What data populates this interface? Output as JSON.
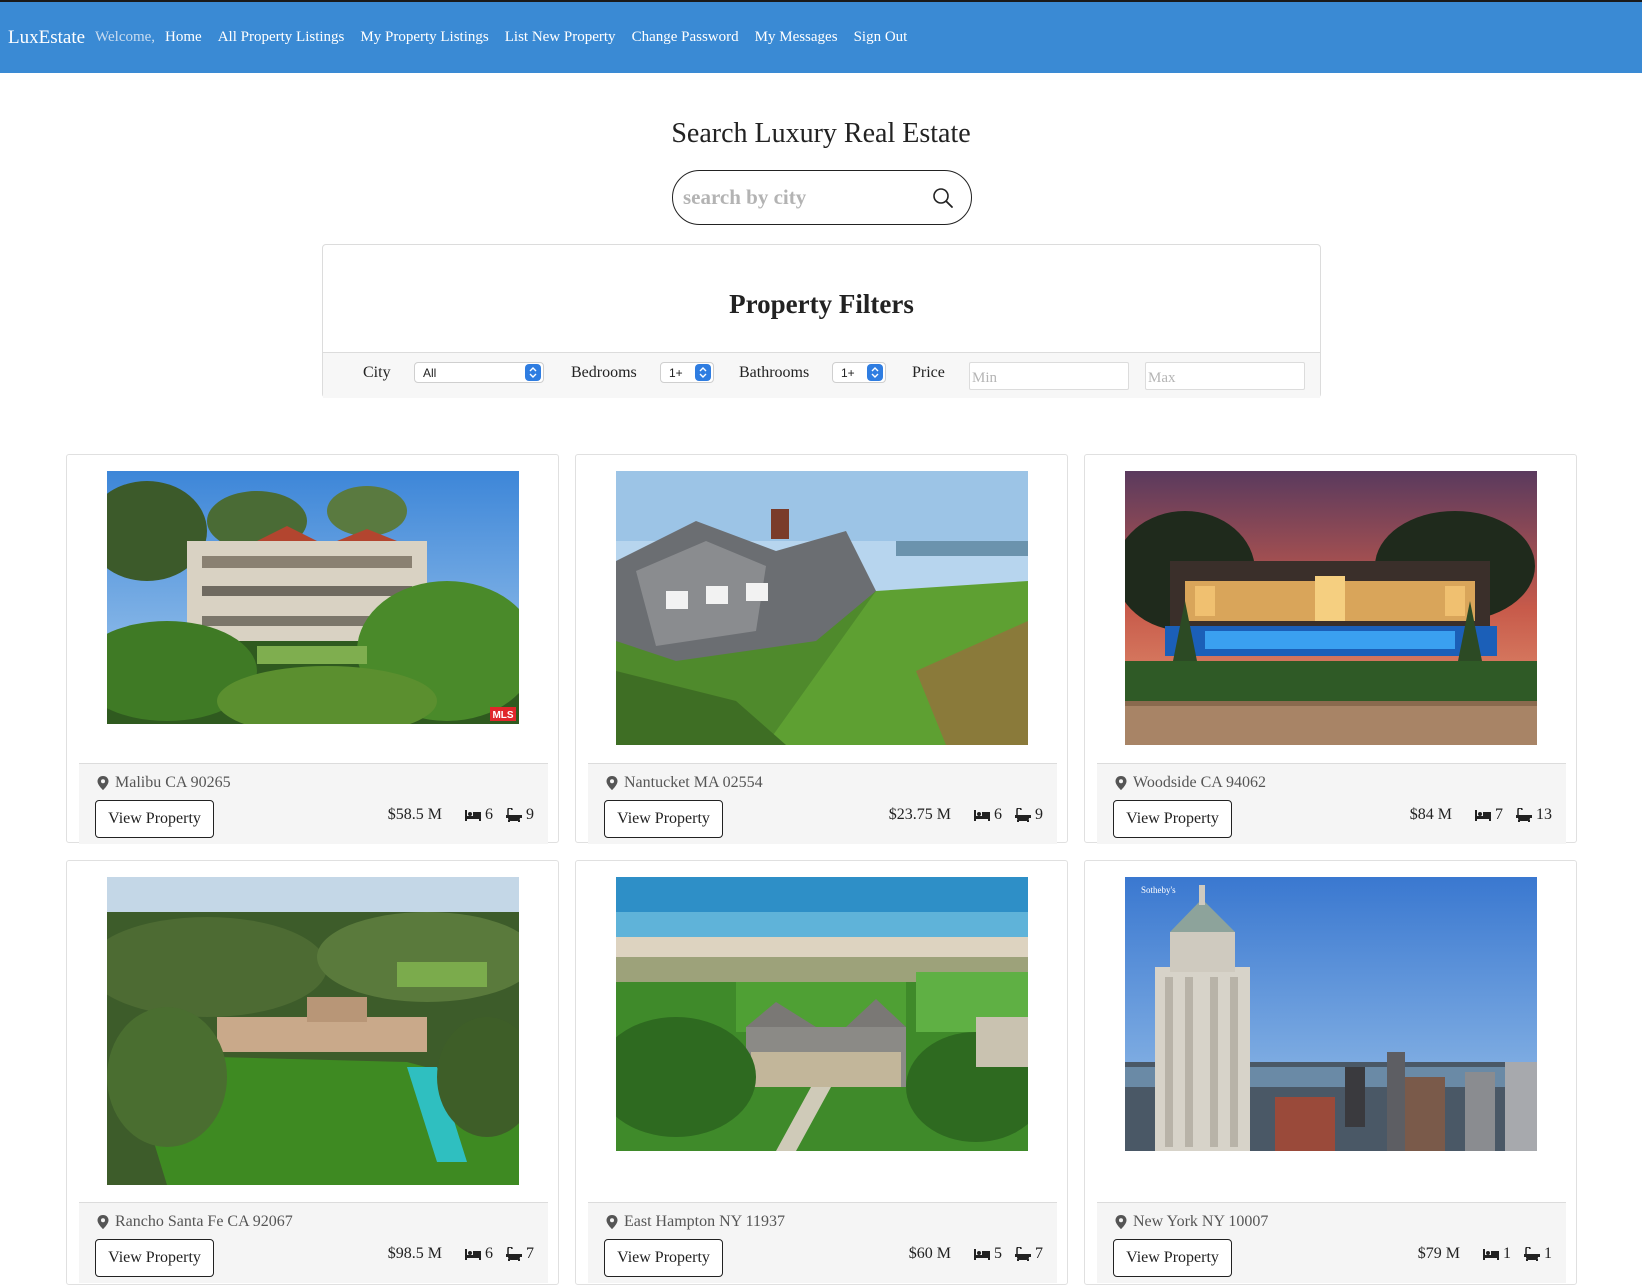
{
  "nav": {
    "brand": "LuxEstate",
    "welcome": "Welcome,",
    "links": [
      "Home",
      "All Property Listings",
      "My Property Listings",
      "List New Property",
      "Change Password",
      "My Messages",
      "Sign Out"
    ]
  },
  "search": {
    "title": "Search Luxury Real Estate",
    "placeholder": "search by city"
  },
  "filters": {
    "title": "Property Filters",
    "city_label": "City",
    "city_value": "All",
    "bedrooms_label": "Bedrooms",
    "bedrooms_value": "1+",
    "bathrooms_label": "Bathrooms",
    "bathrooms_value": "1+",
    "price_label": "Price",
    "min_placeholder": "Min",
    "max_placeholder": "Max"
  },
  "colors": {
    "navbar": "#3a8ad4",
    "select_arrow": "#2f7de1"
  },
  "listings": [
    {
      "location": "Malibu CA 90265",
      "price": "$58.5 M",
      "beds": "6",
      "baths": "9",
      "button": "View Property"
    },
    {
      "location": "Nantucket MA 02554",
      "price": "$23.75 M",
      "beds": "6",
      "baths": "9",
      "button": "View Property"
    },
    {
      "location": "Woodside CA 94062",
      "price": "$84 M",
      "beds": "7",
      "baths": "13",
      "button": "View Property"
    },
    {
      "location": "Rancho Santa Fe CA 92067",
      "price": "$98.5 M",
      "beds": "6",
      "baths": "7",
      "button": "View Property"
    },
    {
      "location": "East Hampton NY 11937",
      "price": "$60 M",
      "beds": "5",
      "baths": "7",
      "button": "View Property"
    },
    {
      "location": "New York NY 10007",
      "price": "$79 M",
      "beds": "1",
      "baths": "1",
      "button": "View Property"
    }
  ],
  "photo_marks": {
    "mls": "MLS",
    "sothebys": "Sotheby's"
  }
}
